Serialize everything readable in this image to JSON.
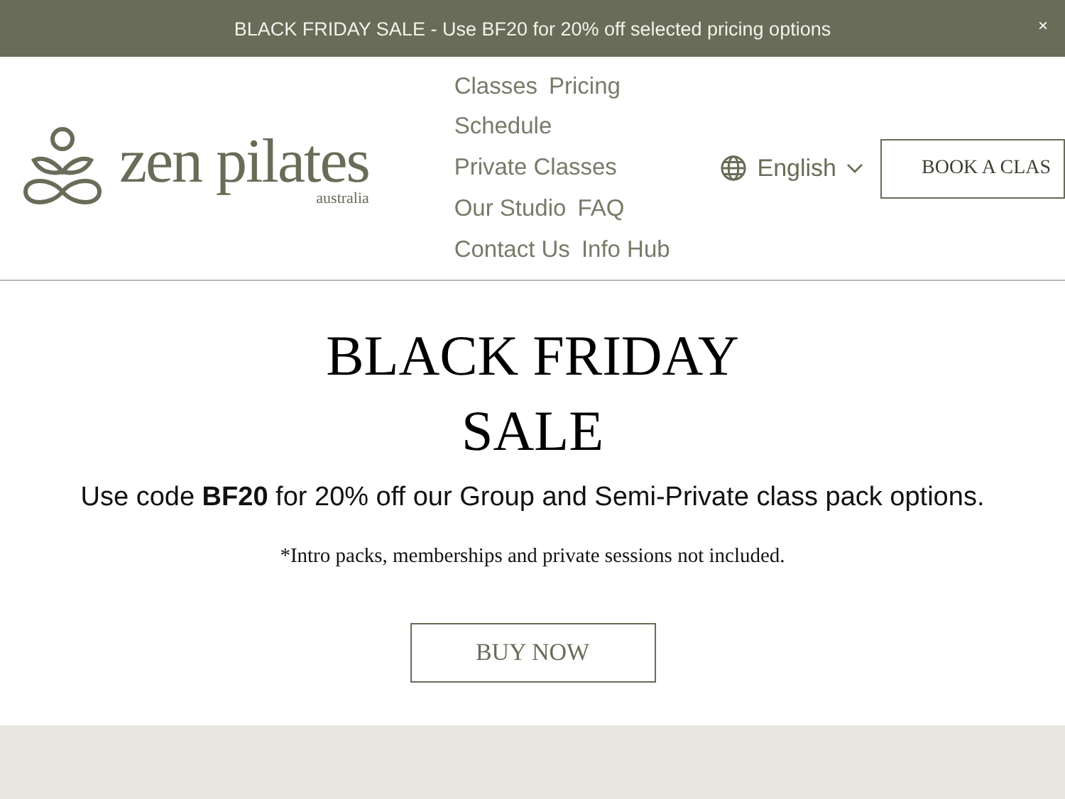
{
  "announcement": {
    "text": "BLACK FRIDAY SALE - Use BF20 for 20% off selected pricing options",
    "close": "×"
  },
  "logo": {
    "name": "zen pilates",
    "subtitle": "australia"
  },
  "nav": {
    "rows": [
      [
        "Classes",
        "Pricing"
      ],
      [
        "Schedule"
      ],
      [
        "Private Classes"
      ],
      [
        "Our Studio",
        "FAQ"
      ],
      [
        "Contact Us",
        "Info Hub"
      ]
    ]
  },
  "language": {
    "label": "English"
  },
  "book_button": "BOOK A CLAS",
  "hero": {
    "title_lines": [
      "BLACK FRIDAY",
      "SALE"
    ],
    "subtitle": "Use code **BF20** for 20% off our Group and Semi-Private class pack options.",
    "note": "*Intro packs, memberships and private sessions not included.",
    "button": "BUY NOW"
  }
}
